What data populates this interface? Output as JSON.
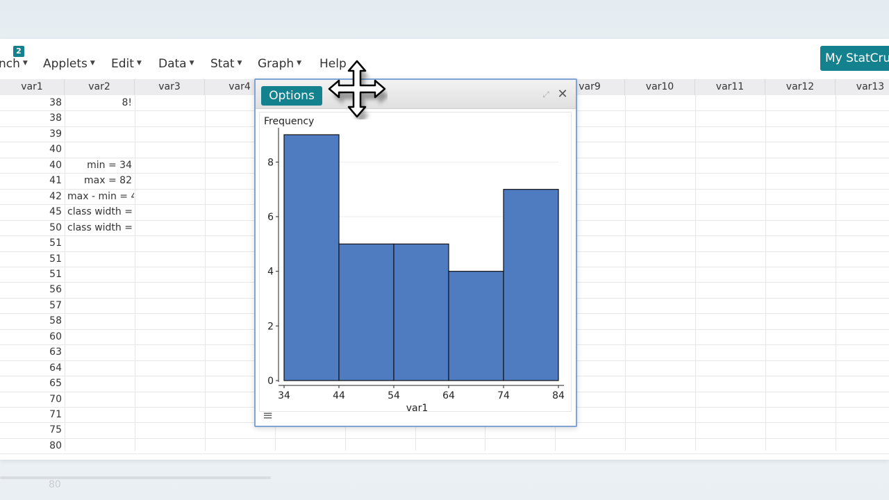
{
  "menubar": {
    "badge": "2",
    "items": [
      {
        "label": "nch"
      },
      {
        "label": "Applets"
      },
      {
        "label": "Edit"
      },
      {
        "label": "Data"
      },
      {
        "label": "Stat"
      },
      {
        "label": "Graph"
      },
      {
        "label": "Help"
      }
    ],
    "my_statcrunch": "My StatCrunch"
  },
  "grid": {
    "columns": [
      "var1",
      "var2",
      "var3",
      "var4",
      "var9",
      "var10",
      "var11",
      "var12",
      "var13"
    ],
    "var1": [
      "38",
      "38",
      "39",
      "40",
      "40",
      "41",
      "42",
      "45",
      "50",
      "51",
      "51",
      "51",
      "56",
      "57",
      "58",
      "60",
      "63",
      "64",
      "65",
      "70",
      "71",
      "75",
      "80"
    ],
    "var2": [
      "8!",
      "",
      "",
      "",
      "min = 34",
      "max = 82",
      "max - min = 4",
      "class width =",
      "class width =",
      "",
      "",
      "",
      "",
      "",
      "",
      "",
      "",
      "",
      "",
      "",
      "",
      "",
      ""
    ]
  },
  "ghost_text": "80",
  "window": {
    "options_label": "Options",
    "expand_icon": "⤢",
    "close_icon": "✕",
    "menu_icon": "≡"
  },
  "chart_data": {
    "type": "bar",
    "title": "",
    "xlabel": "var1",
    "ylabel": "Frequency",
    "bin_edges": [
      34,
      44,
      54,
      64,
      74,
      84
    ],
    "x_ticks": [
      "34",
      "44",
      "54",
      "64",
      "74",
      "84"
    ],
    "values": [
      9,
      5,
      5,
      4,
      7
    ],
    "y_ticks": [
      "0",
      "2",
      "4",
      "6",
      "8"
    ],
    "ylim": [
      0,
      9
    ],
    "grid": true,
    "bar_color": "#4f7bc1"
  },
  "colors": {
    "accent": "#14818f",
    "window_border": "#7fa3d4"
  }
}
